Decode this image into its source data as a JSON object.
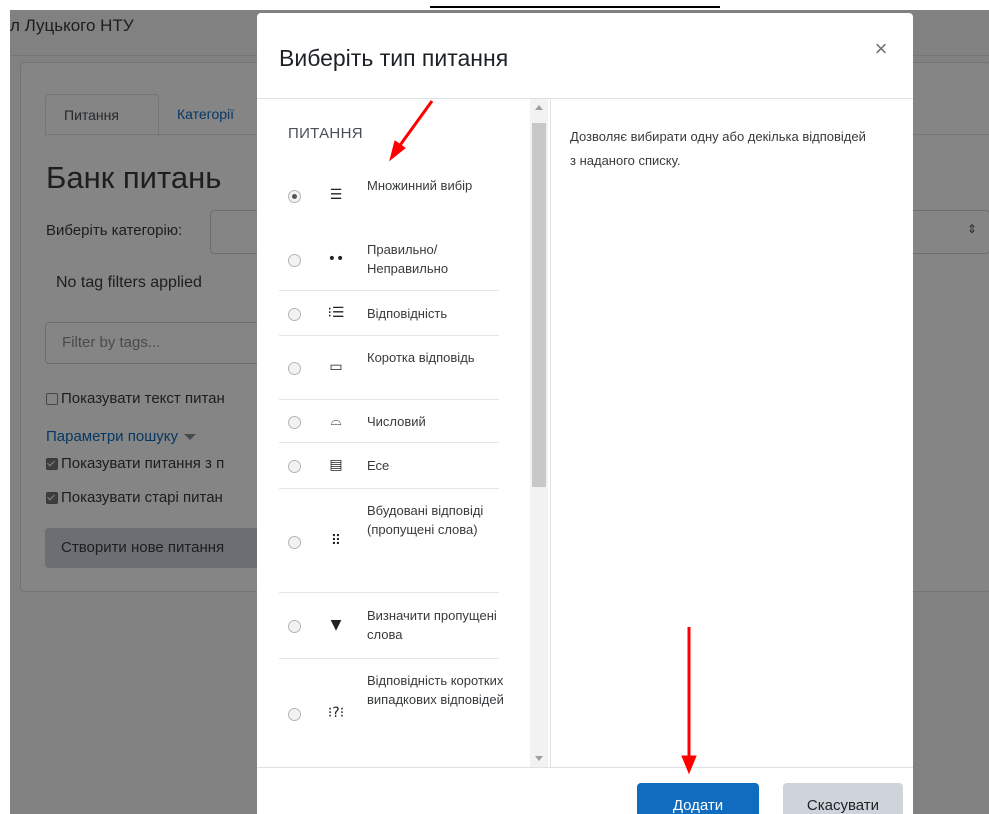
{
  "site": {
    "name": "л Луцького НТУ",
    "tabs": [
      "Питання",
      "Категорії"
    ],
    "heading": "Банк питань",
    "category_label": "Виберіть категорію:",
    "no_tag": "No tag filters applied",
    "filter_placeholder": "Filter by tags...",
    "show_text": "Показувати текст питан",
    "search_params": "Параметри пошуку",
    "show_sub": "Показувати питання з п",
    "show_old": "Показувати старі питан",
    "create_button": "Створити нове питання"
  },
  "modal": {
    "title": "Виберіть тип питання",
    "close_icon": "×",
    "section_header": "ПИТАННЯ",
    "description": "Дозволяє вибирати одну або декілька відповідей з наданого списку.",
    "items": [
      {
        "label": "Множинний вибір",
        "icon": "☰",
        "selected": true
      },
      {
        "label": "Правильно/ Неправильно",
        "icon": "••",
        "selected": false
      },
      {
        "label": "Відповідність",
        "icon": "⁝☰",
        "selected": false
      },
      {
        "label": "Коротка відповідь",
        "icon": "▭",
        "selected": false
      },
      {
        "label": "Числовий",
        "icon": "⌓",
        "selected": false
      },
      {
        "label": "Есе",
        "icon": "▤",
        "selected": false
      },
      {
        "label": "Вбудовані відповіді (пропущені слова)",
        "icon": "⠿",
        "selected": false
      },
      {
        "label": "Визначити пропущені слова",
        "icon": "▼",
        "selected": false
      },
      {
        "label": "Відповідність коротких випадкових відповідей",
        "icon": "⁝?⁝",
        "selected": false
      }
    ],
    "add_button": "Додати",
    "cancel_button": "Скасувати"
  },
  "annotation_color": "#ff0000"
}
